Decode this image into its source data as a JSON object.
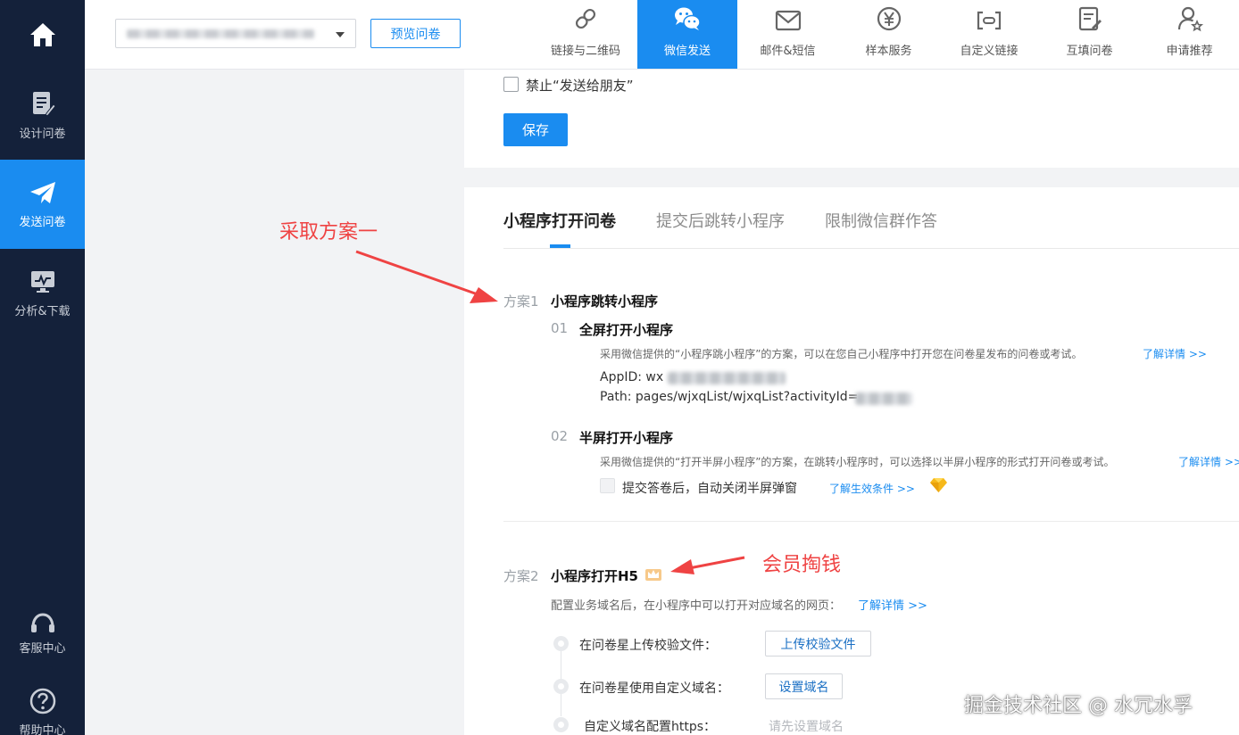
{
  "sidebar": {
    "items": [
      {
        "label": "设计问卷"
      },
      {
        "label": "发送问卷"
      },
      {
        "label": "分析&下载"
      }
    ],
    "bottom": [
      {
        "label": "客服中心"
      },
      {
        "label": "帮助中心"
      }
    ]
  },
  "topbar": {
    "preview_label": "预览问卷",
    "tabs": [
      {
        "label": "链接与二维码"
      },
      {
        "label": "微信发送"
      },
      {
        "label": "邮件&短信"
      },
      {
        "label": "样本服务"
      },
      {
        "label": "自定义链接"
      },
      {
        "label": "互填问卷"
      },
      {
        "label": "申请推荐"
      }
    ]
  },
  "settings": {
    "forbid_share_label": "禁止“发送给朋友”",
    "save_label": "保存"
  },
  "tabs": [
    {
      "label": "小程序打开问卷"
    },
    {
      "label": "提交后跳转小程序"
    },
    {
      "label": "限制微信群作答"
    }
  ],
  "plan1": {
    "tag": "方案1",
    "title": "小程序跳转小程序",
    "step1": {
      "num": "01",
      "title": "全屏打开小程序",
      "desc": "采用微信提供的“小程序跳小程序”的方案，可以在您自己小程序中打开您在问卷星发布的问卷或考试。",
      "link": "了解详情 >>",
      "appid_label": "AppID: wx",
      "path_label": "Path: pages/wjxqList/wjxqList?activityId="
    },
    "step2": {
      "num": "02",
      "title": "半屏打开小程序",
      "desc": "采用微信提供的“打开半屏小程序”的方案，在跳转小程序时，可以选择以半屏小程序的形式打开问卷或考试。",
      "link": "了解详情 >>",
      "close_label": "提交答卷后，自动关闭半屏弹窗",
      "condition_link": "了解生效条件 >>"
    }
  },
  "plan2": {
    "tag": "方案2",
    "title": "小程序打开H5",
    "desc": "配置业务域名后，在小程序中可以打开对应域名的网页：",
    "link": "了解详情 >>",
    "steps": [
      {
        "label": "在问卷星上传校验文件：",
        "action": "上传校验文件"
      },
      {
        "label": "在问卷星使用自定义域名：",
        "action": "设置域名"
      },
      {
        "label": "自定义域名配置https：",
        "action": "请先设置域名"
      }
    ]
  },
  "annotations": {
    "plan1_note": "采取方案一",
    "plan2_note": "会员掏钱"
  },
  "watermark": "掘金技术社区 @ 水冗水孚",
  "colors": {
    "sidebar_bg": "#14213a",
    "accent": "#1a8cf0",
    "annotation": "#ef4343"
  },
  "icons": {
    "home": "home-icon",
    "design": "document-edit-icon",
    "send": "paper-plane-icon",
    "analysis": "monitor-chart-icon",
    "support": "headset-icon",
    "help": "question-circle-icon"
  }
}
